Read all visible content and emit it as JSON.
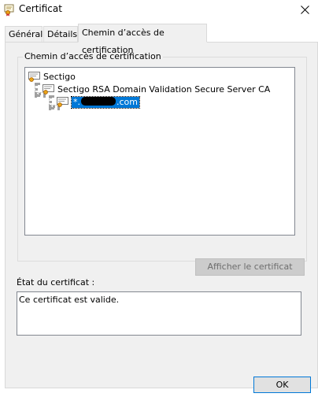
{
  "window": {
    "title": "Certificat",
    "close_icon": "close-icon"
  },
  "tabs": [
    {
      "label": "Général"
    },
    {
      "label": "Détails"
    },
    {
      "label": "Chemin d’accès de certification",
      "active": true
    }
  ],
  "cert_path": {
    "group_label": "Chemin d’accès de certification",
    "nodes": [
      {
        "label": "Sectigo",
        "level": 0
      },
      {
        "label": "Sectigo RSA Domain Validation Secure Server CA",
        "level": 1
      },
      {
        "label_prefix": "*.",
        "label_suffix": ".com",
        "redacted": true,
        "level": 2,
        "selected": true
      }
    ],
    "view_button": "Afficher le certificat"
  },
  "status": {
    "label": "État du certificat :",
    "text": "Ce certificat est valide."
  },
  "ok_button": "OK",
  "colors": {
    "selection": "#0078d7",
    "panel": "#f0f0f0",
    "default_border": "#0078d7"
  }
}
